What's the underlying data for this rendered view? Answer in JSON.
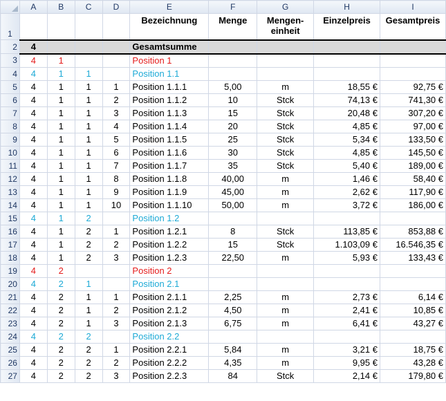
{
  "columns": [
    "A",
    "B",
    "C",
    "D",
    "E",
    "F",
    "G",
    "H",
    "I"
  ],
  "header_row": {
    "num": "1",
    "bezeichnung": "Bezeichnung",
    "menge": "Menge",
    "einheit_line1": "Mengen-",
    "einheit_line2": "einheit",
    "einzelpreis": "Einzelpreis",
    "gesamtpreis": "Gesamtpreis"
  },
  "total_row": {
    "num": "2",
    "a": "4",
    "label": "Gesamtsumme"
  },
  "rows": [
    {
      "num": "3",
      "a": "4",
      "b": "1",
      "c": "",
      "d": "",
      "e": "Position 1",
      "f": "",
      "g": "",
      "h": "",
      "i": "",
      "level": "red"
    },
    {
      "num": "4",
      "a": "4",
      "b": "1",
      "c": "1",
      "d": "",
      "e": "Position 1.1",
      "f": "",
      "g": "",
      "h": "",
      "i": "",
      "level": "cyan"
    },
    {
      "num": "5",
      "a": "4",
      "b": "1",
      "c": "1",
      "d": "1",
      "e": "Position 1.1.1",
      "f": "5,00",
      "g": "m",
      "h": "18,55 €",
      "i": "92,75 €",
      "level": "item"
    },
    {
      "num": "6",
      "a": "4",
      "b": "1",
      "c": "1",
      "d": "2",
      "e": "Position 1.1.2",
      "f": "10",
      "g": "Stck",
      "h": "74,13 €",
      "i": "741,30 €",
      "level": "item"
    },
    {
      "num": "7",
      "a": "4",
      "b": "1",
      "c": "1",
      "d": "3",
      "e": "Position 1.1.3",
      "f": "15",
      "g": "Stck",
      "h": "20,48 €",
      "i": "307,20 €",
      "level": "item"
    },
    {
      "num": "8",
      "a": "4",
      "b": "1",
      "c": "1",
      "d": "4",
      "e": "Position 1.1.4",
      "f": "20",
      "g": "Stck",
      "h": "4,85 €",
      "i": "97,00 €",
      "level": "item"
    },
    {
      "num": "9",
      "a": "4",
      "b": "1",
      "c": "1",
      "d": "5",
      "e": "Position 1.1.5",
      "f": "25",
      "g": "Stck",
      "h": "5,34 €",
      "i": "133,50 €",
      "level": "item"
    },
    {
      "num": "10",
      "a": "4",
      "b": "1",
      "c": "1",
      "d": "6",
      "e": "Position 1.1.6",
      "f": "30",
      "g": "Stck",
      "h": "4,85 €",
      "i": "145,50 €",
      "level": "item"
    },
    {
      "num": "11",
      "a": "4",
      "b": "1",
      "c": "1",
      "d": "7",
      "e": "Position 1.1.7",
      "f": "35",
      "g": "Stck",
      "h": "5,40 €",
      "i": "189,00 €",
      "level": "item"
    },
    {
      "num": "12",
      "a": "4",
      "b": "1",
      "c": "1",
      "d": "8",
      "e": "Position 1.1.8",
      "f": "40,00",
      "g": "m",
      "h": "1,46 €",
      "i": "58,40 €",
      "level": "item"
    },
    {
      "num": "13",
      "a": "4",
      "b": "1",
      "c": "1",
      "d": "9",
      "e": "Position 1.1.9",
      "f": "45,00",
      "g": "m",
      "h": "2,62 €",
      "i": "117,90 €",
      "level": "item"
    },
    {
      "num": "14",
      "a": "4",
      "b": "1",
      "c": "1",
      "d": "10",
      "e": "Position 1.1.10",
      "f": "50,00",
      "g": "m",
      "h": "3,72 €",
      "i": "186,00 €",
      "level": "item"
    },
    {
      "num": "15",
      "a": "4",
      "b": "1",
      "c": "2",
      "d": "",
      "e": "Position 1.2",
      "f": "",
      "g": "",
      "h": "",
      "i": "",
      "level": "cyan"
    },
    {
      "num": "16",
      "a": "4",
      "b": "1",
      "c": "2",
      "d": "1",
      "e": "Position 1.2.1",
      "f": "8",
      "g": "Stck",
      "h": "113,85 €",
      "i": "853,88 €",
      "level": "item"
    },
    {
      "num": "17",
      "a": "4",
      "b": "1",
      "c": "2",
      "d": "2",
      "e": "Position 1.2.2",
      "f": "15",
      "g": "Stck",
      "h": "1.103,09 €",
      "i": "16.546,35 €",
      "level": "item"
    },
    {
      "num": "18",
      "a": "4",
      "b": "1",
      "c": "2",
      "d": "3",
      "e": "Position 1.2.3",
      "f": "22,50",
      "g": "m",
      "h": "5,93 €",
      "i": "133,43 €",
      "level": "item"
    },
    {
      "num": "19",
      "a": "4",
      "b": "2",
      "c": "",
      "d": "",
      "e": "Position 2",
      "f": "",
      "g": "",
      "h": "",
      "i": "",
      "level": "red"
    },
    {
      "num": "20",
      "a": "4",
      "b": "2",
      "c": "1",
      "d": "",
      "e": "Position 2.1",
      "f": "",
      "g": "",
      "h": "",
      "i": "",
      "level": "cyan"
    },
    {
      "num": "21",
      "a": "4",
      "b": "2",
      "c": "1",
      "d": "1",
      "e": "Position 2.1.1",
      "f": "2,25",
      "g": "m",
      "h": "2,73 €",
      "i": "6,14 €",
      "level": "item"
    },
    {
      "num": "22",
      "a": "4",
      "b": "2",
      "c": "1",
      "d": "2",
      "e": "Position 2.1.2",
      "f": "4,50",
      "g": "m",
      "h": "2,41 €",
      "i": "10,85 €",
      "level": "item"
    },
    {
      "num": "23",
      "a": "4",
      "b": "2",
      "c": "1",
      "d": "3",
      "e": "Position 2.1.3",
      "f": "6,75",
      "g": "m",
      "h": "6,41 €",
      "i": "43,27 €",
      "level": "item"
    },
    {
      "num": "24",
      "a": "4",
      "b": "2",
      "c": "2",
      "d": "",
      "e": "Position 2.2",
      "f": "",
      "g": "",
      "h": "",
      "i": "",
      "level": "cyan"
    },
    {
      "num": "25",
      "a": "4",
      "b": "2",
      "c": "2",
      "d": "1",
      "e": "Position 2.2.1",
      "f": "5,84",
      "g": "m",
      "h": "3,21 €",
      "i": "18,75 €",
      "level": "item"
    },
    {
      "num": "26",
      "a": "4",
      "b": "2",
      "c": "2",
      "d": "2",
      "e": "Position 2.2.2",
      "f": "4,35",
      "g": "m",
      "h": "9,95 €",
      "i": "43,28 €",
      "level": "item"
    },
    {
      "num": "27",
      "a": "4",
      "b": "2",
      "c": "2",
      "d": "3",
      "e": "Position 2.2.3",
      "f": "84",
      "g": "Stck",
      "h": "2,14 €",
      "i": "179,80 €",
      "level": "item"
    }
  ],
  "colors": {
    "level1": "#e41c1c",
    "level2": "#1eaad6",
    "grid": "#d0d7e5",
    "header_bg": "#dfe7f2",
    "total_bg": "#d9d9d9"
  }
}
